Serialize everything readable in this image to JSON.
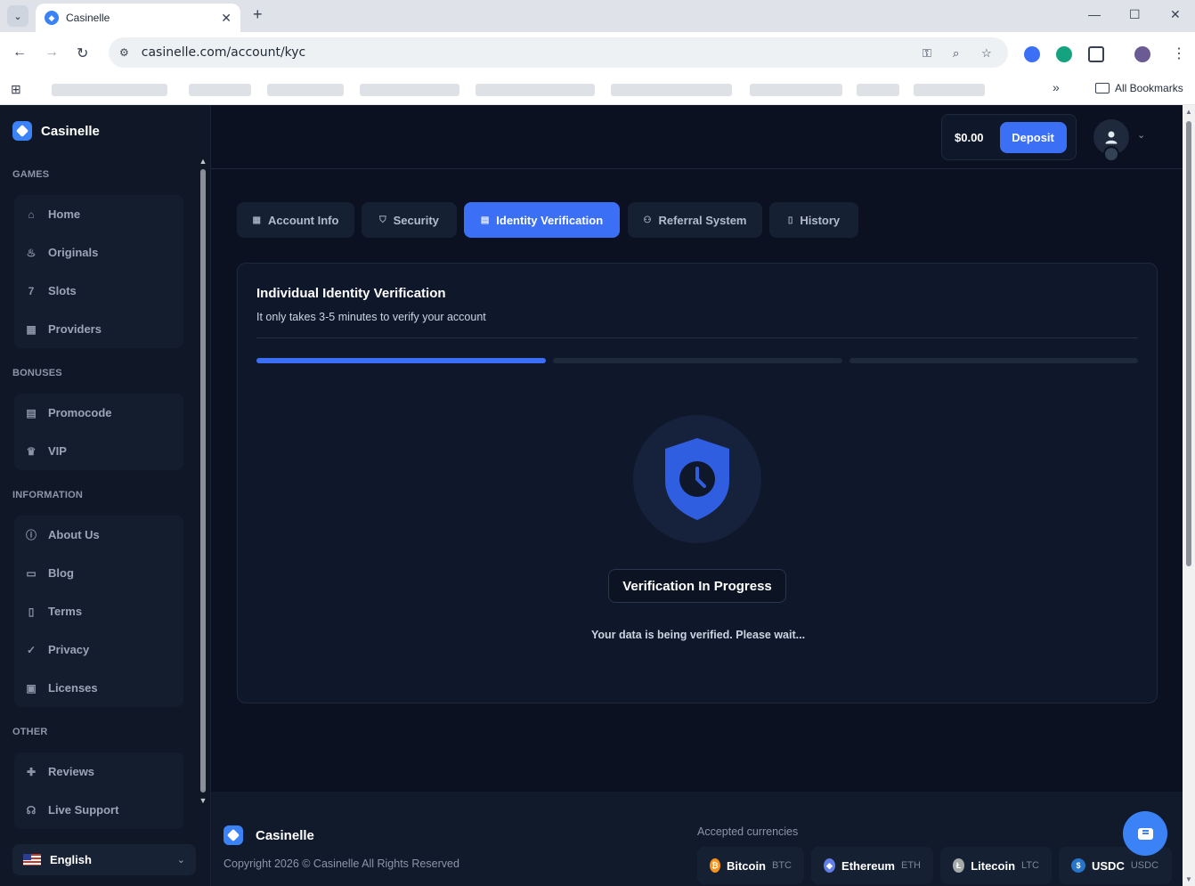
{
  "browser": {
    "tab_title": "Casinelle",
    "url": "casinelle.com/account/kyc",
    "all_bookmarks": "All Bookmarks"
  },
  "sidebar": {
    "brand": "Casinelle",
    "sections": {
      "games": "GAMES",
      "bonuses": "BONUSES",
      "information": "INFORMATION",
      "other": "OTHER"
    },
    "games": [
      {
        "label": "Home",
        "icon": "home-icon"
      },
      {
        "label": "Originals",
        "icon": "flame-icon"
      },
      {
        "label": "Slots",
        "icon": "slots-777-icon"
      },
      {
        "label": "Providers",
        "icon": "grid-icon"
      }
    ],
    "bonuses": [
      {
        "label": "Promocode",
        "icon": "ticket-icon"
      },
      {
        "label": "VIP",
        "icon": "crown-icon"
      }
    ],
    "information": [
      {
        "label": "About Us",
        "icon": "info-icon"
      },
      {
        "label": "Blog",
        "icon": "newspaper-icon"
      },
      {
        "label": "Terms",
        "icon": "document-icon"
      },
      {
        "label": "Privacy",
        "icon": "clipboard-check-icon"
      },
      {
        "label": "Licenses",
        "icon": "certificate-icon"
      }
    ],
    "other": [
      {
        "label": "Reviews",
        "icon": "chat-plus-icon"
      },
      {
        "label": "Live Support",
        "icon": "headset-icon"
      }
    ],
    "language": "English"
  },
  "header": {
    "balance": "$0.00",
    "deposit": "Deposit"
  },
  "tabs": [
    {
      "label": "Account Info",
      "icon": "grid-icon"
    },
    {
      "label": "Security",
      "icon": "shield-icon"
    },
    {
      "label": "Identity Verification",
      "icon": "id-card-icon"
    },
    {
      "label": "Referral System",
      "icon": "users-icon"
    },
    {
      "label": "History",
      "icon": "file-icon"
    }
  ],
  "kyc": {
    "title": "Individual Identity Verification",
    "subtitle": "It only takes 3-5 minutes to verify your account",
    "steps_completed": 1,
    "steps_total": 3,
    "status": "Verification In Progress",
    "message": "Your data is being verified. Please wait..."
  },
  "footer": {
    "brand": "Casinelle",
    "copyright": "Copyright 2026 © Casinelle All Rights Reserved",
    "accepted_title": "Accepted currencies",
    "currencies": [
      {
        "name": "Bitcoin",
        "code": "BTC",
        "color": "#f7931a"
      },
      {
        "name": "Ethereum",
        "code": "ETH",
        "color": "#627eea"
      },
      {
        "name": "Litecoin",
        "code": "LTC",
        "color": "#a6a9aa"
      },
      {
        "name": "USDC",
        "code": "USDC",
        "color": "#2775ca"
      }
    ]
  },
  "colors": {
    "accent": "#3b6ff6",
    "bg": "#0b1120",
    "card": "#0f172a"
  }
}
